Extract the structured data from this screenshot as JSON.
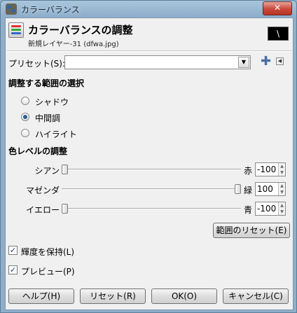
{
  "window": {
    "title": "カラーバランス",
    "app_icon": "gimp-icon",
    "close_label": "✕"
  },
  "header": {
    "title": "カラーバランスの調整",
    "subtitle": "新規レイヤー-31 (dfwa.jpg)",
    "preview_glyph": "\\"
  },
  "preset": {
    "label": "プリセット(S):",
    "value": "",
    "arrow": "▼",
    "add": "✚",
    "menu": "◀"
  },
  "range": {
    "title": "調整する範囲の選択",
    "options": [
      {
        "label": "シャドウ",
        "selected": false
      },
      {
        "label": "中間調",
        "selected": true
      },
      {
        "label": "ハイライト",
        "selected": false
      }
    ]
  },
  "levels": {
    "title": "色レベルの調整",
    "sliders": [
      {
        "left": "シアン",
        "right": "赤",
        "value": "-100",
        "fraction": 0.0
      },
      {
        "left": "マゼンダ",
        "right": "緑",
        "value": "100",
        "fraction": 1.0
      },
      {
        "left": "イエロー",
        "right": "青",
        "value": "-100",
        "fraction": 0.0
      }
    ],
    "reset": "範囲のリセット(E)"
  },
  "options": {
    "preserve": {
      "label": "輝度を保持(L)",
      "checked": true
    },
    "preview": {
      "label": "プレビュー(P)",
      "checked": true
    }
  },
  "buttons": {
    "help": "ヘルプ(H)",
    "reset": "リセット(R)",
    "ok": "OK(O)",
    "cancel": "キャンセル(C)"
  },
  "colors": {
    "accent": "#2e5e8e",
    "titlebar": "#8eaecb"
  }
}
